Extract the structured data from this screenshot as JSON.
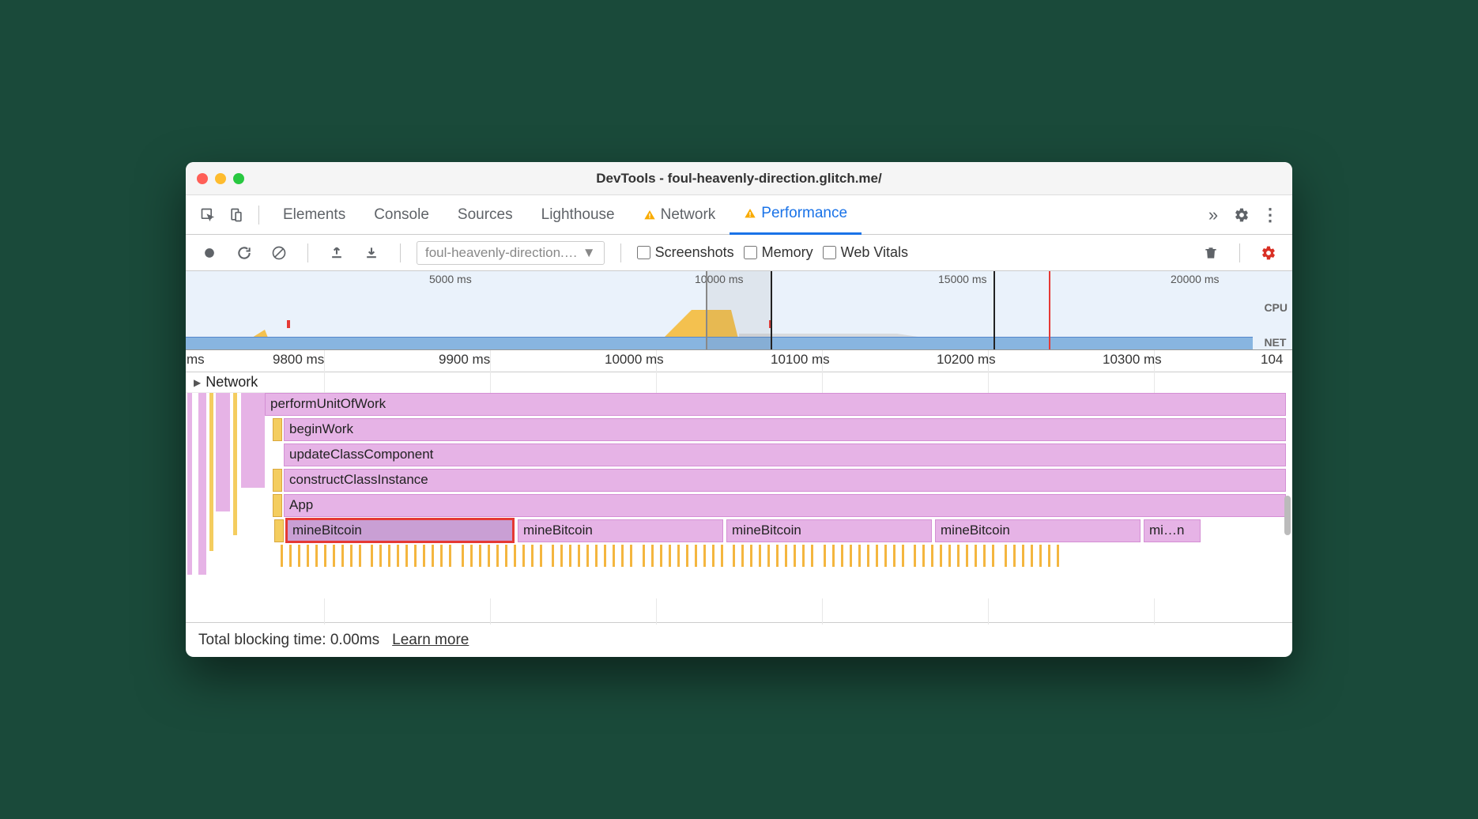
{
  "window": {
    "title": "DevTools - foul-heavenly-direction.glitch.me/"
  },
  "tabs": {
    "elements": "Elements",
    "console": "Console",
    "sources": "Sources",
    "lighthouse": "Lighthouse",
    "network": "Network",
    "performance": "Performance"
  },
  "toolbar": {
    "profile_select": "foul-heavenly-direction.…",
    "screenshots": "Screenshots",
    "memory": "Memory",
    "web_vitals": "Web Vitals"
  },
  "overview": {
    "ticks": [
      "5000 ms",
      "10000 ms",
      "15000 ms",
      "20000 ms"
    ],
    "cpu_label": "CPU",
    "net_label": "NET"
  },
  "ruler": {
    "ticks": [
      "ms",
      "9800 ms",
      "9900 ms",
      "10000 ms",
      "10100 ms",
      "10200 ms",
      "10300 ms",
      "104"
    ]
  },
  "tracks": {
    "network": "Network"
  },
  "flame": {
    "rows": [
      "performUnitOfWork",
      "beginWork",
      "updateClassComponent",
      "constructClassInstance",
      "App"
    ],
    "mine": [
      "mineBitcoin",
      "mineBitcoin",
      "mineBitcoin",
      "mineBitcoin",
      "mi…n"
    ]
  },
  "status": {
    "tbt": "Total blocking time: 0.00ms",
    "learn_more": "Learn more"
  }
}
